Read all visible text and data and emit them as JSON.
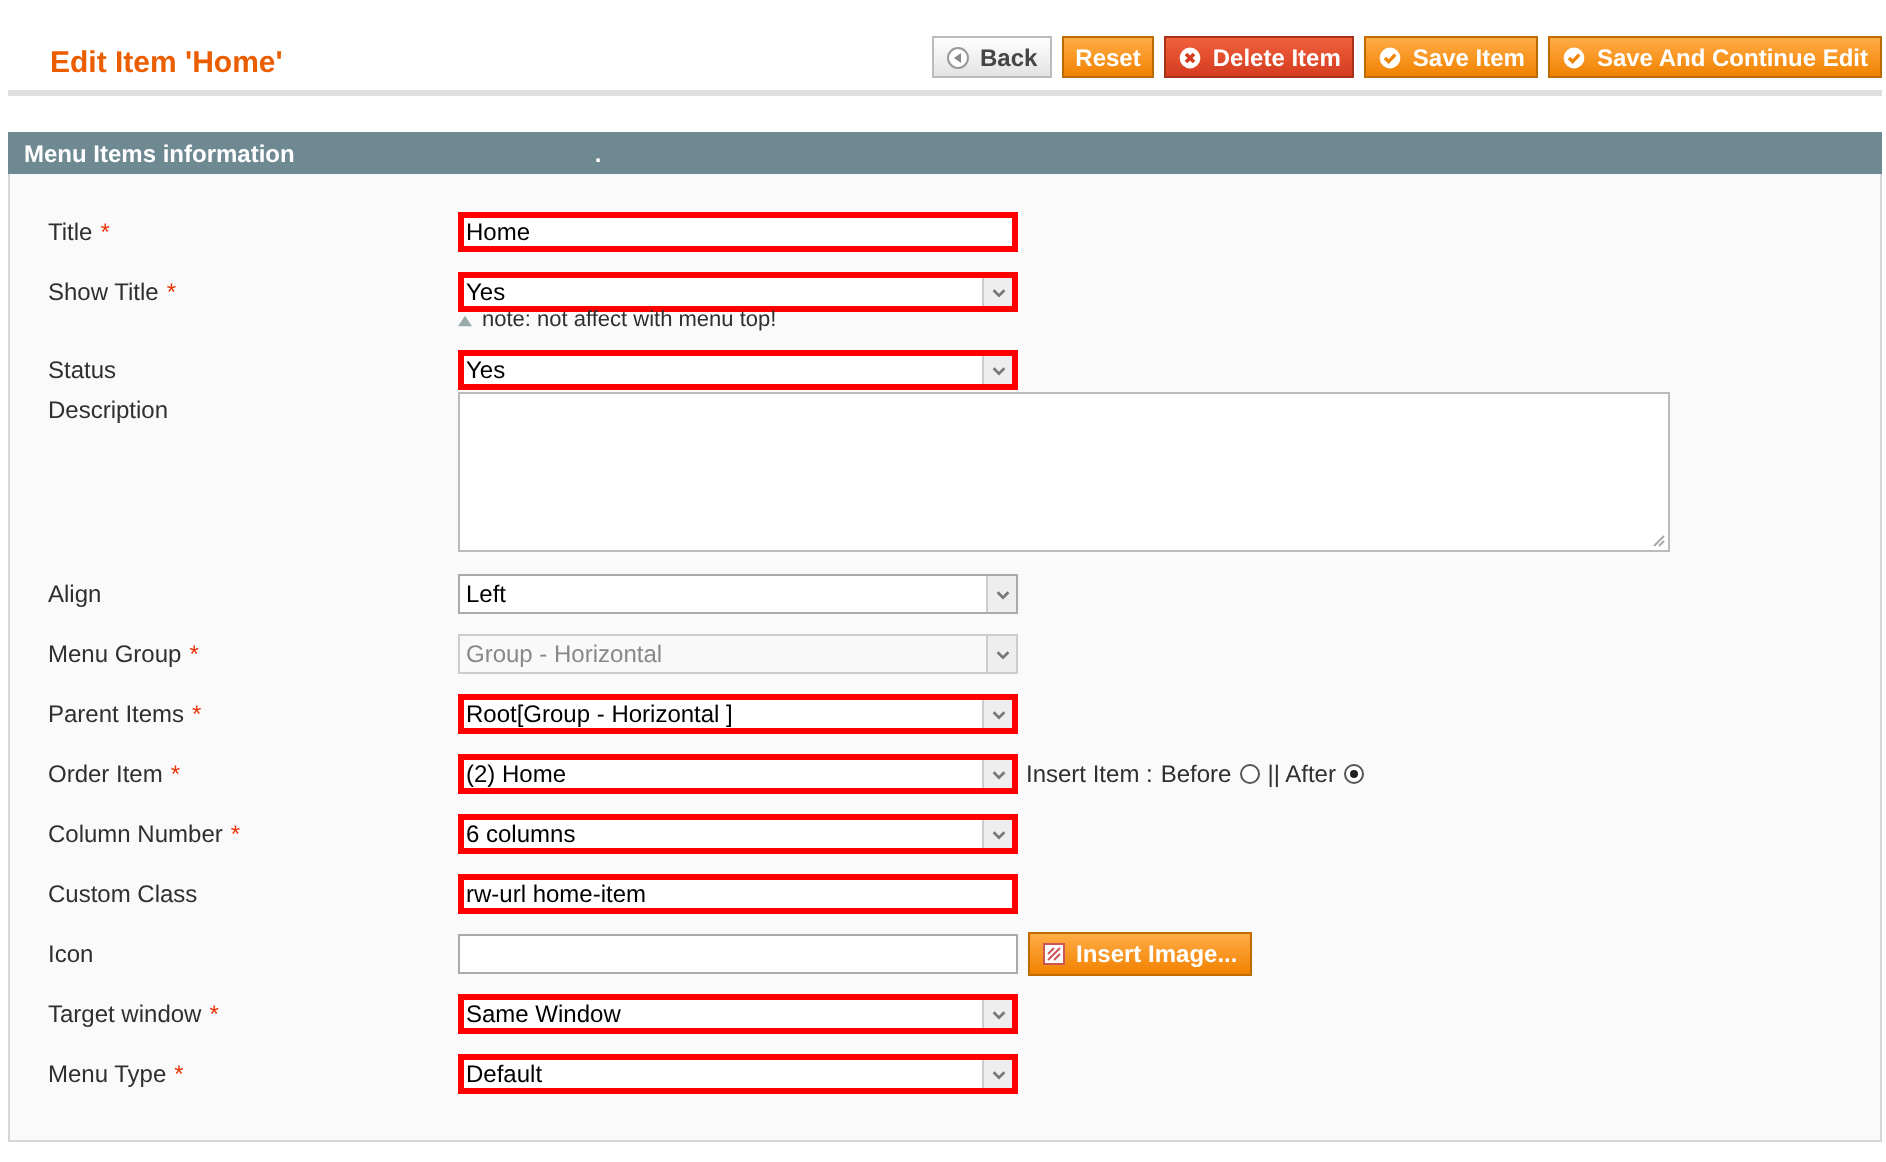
{
  "page": {
    "title": "Edit Item 'Home'"
  },
  "buttons": [
    {
      "label": "Back",
      "kind": "back"
    },
    {
      "label": "Reset",
      "kind": "plain"
    },
    {
      "label": "Delete Item",
      "kind": "delete"
    },
    {
      "label": "Save Item",
      "kind": "save"
    },
    {
      "label": "Save And Continue Edit",
      "kind": "save"
    }
  ],
  "section": {
    "title": "Menu Items information",
    "mark": "."
  },
  "fields": [
    {
      "label": "Title",
      "required": "*",
      "kind": "text",
      "value": "Home",
      "highlighted": true
    },
    {
      "label": "Show Title",
      "required": "*",
      "kind": "select",
      "value": "Yes",
      "highlighted": true,
      "note": "note: not affect with menu top!"
    },
    {
      "label": "Status",
      "kind": "select",
      "value": "Yes",
      "highlighted": true
    },
    {
      "label": "Description",
      "kind": "textarea",
      "highlighted": false
    },
    {
      "label": "Align",
      "kind": "select",
      "value": "Left",
      "highlighted": false
    },
    {
      "label": "Menu Group",
      "required": "*",
      "kind": "select",
      "value": "Group - Horizontal",
      "highlighted": false,
      "disabled": true
    },
    {
      "label": "Parent Items",
      "required": "*",
      "kind": "select",
      "value": "Root[Group - Horizontal ]",
      "highlighted": true
    },
    {
      "label": "Order Item",
      "required": "*",
      "kind": "select",
      "value": "(2) Home",
      "highlighted": true,
      "insert": {
        "label": "Insert Item :",
        "options": [
          {
            "label": "Before",
            "selected": false
          },
          {
            "label": "|| After",
            "selected": true
          }
        ]
      }
    },
    {
      "label": "Column Number",
      "required": "*",
      "kind": "select",
      "value": "6 columns",
      "highlighted": true
    },
    {
      "label": "Custom Class",
      "kind": "text",
      "value": "rw-url home-item",
      "highlighted": true
    },
    {
      "label": "Icon",
      "kind": "text",
      "highlighted": false,
      "button": "Insert Image..."
    },
    {
      "label": "Target window",
      "required": "*",
      "kind": "select",
      "value": "Same Window",
      "highlighted": true
    },
    {
      "label": "Menu Type",
      "required": "*",
      "kind": "select",
      "value": "Default",
      "highlighted": true
    }
  ]
}
